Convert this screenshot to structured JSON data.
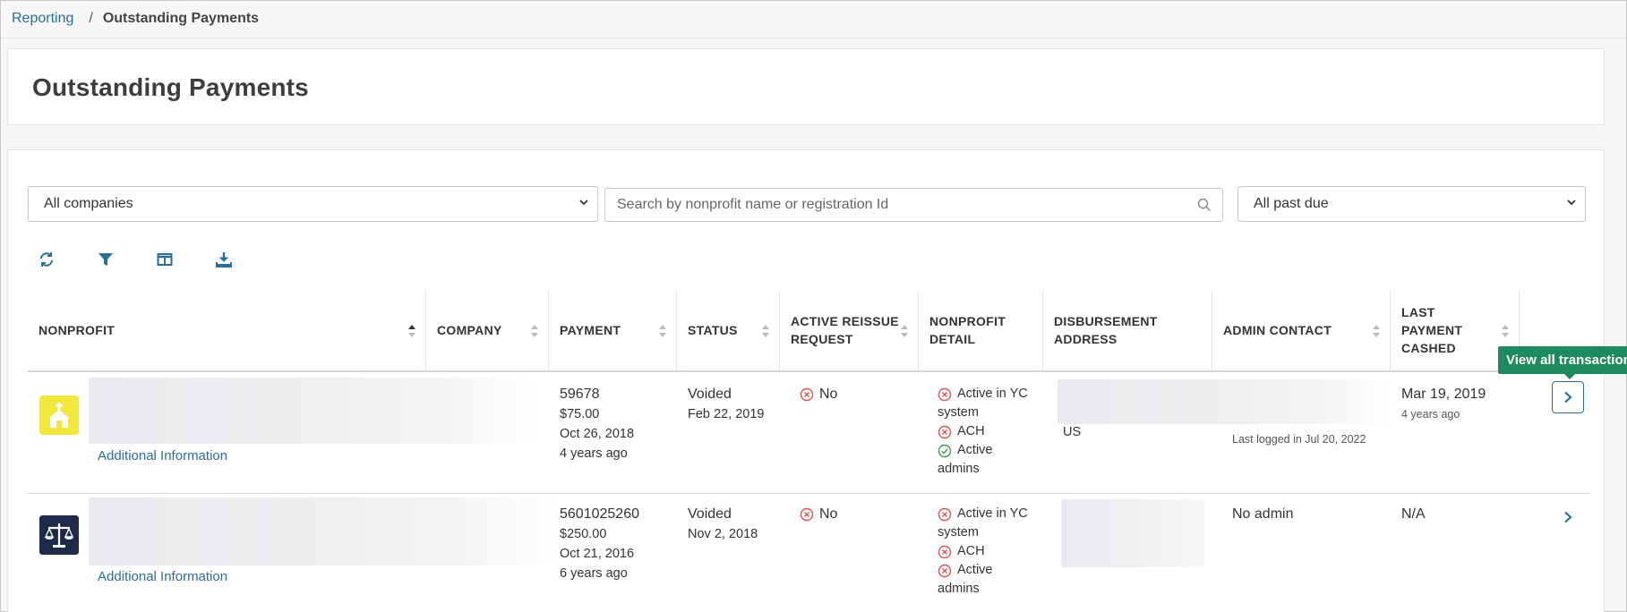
{
  "breadcrumb": {
    "parent": "Reporting",
    "separator": "/",
    "current": "Outstanding Payments"
  },
  "page_title": "Outstanding Payments",
  "filters": {
    "company_select": "All companies",
    "search_placeholder": "Search by nonprofit name or registration Id",
    "due_select": "All past due"
  },
  "toolbar": [
    "refresh-icon",
    "filter-icon",
    "columns-icon",
    "download-icon"
  ],
  "columns": {
    "nonprofit": "NONPROFIT",
    "company": "COMPANY",
    "payment": "PAYMENT",
    "status": "STATUS",
    "reissue": [
      "ACTIVE REISSUE",
      "REQUEST"
    ],
    "detail": [
      "NONPROFIT",
      "DETAIL"
    ],
    "address": [
      "DISBURSEMENT",
      "ADDRESS"
    ],
    "admin": "ADMIN CONTACT",
    "cashed": [
      "LAST",
      "PAYMENT",
      "CASHED"
    ]
  },
  "rows": [
    {
      "additional_info": "Additional Information",
      "payment_id": "59678",
      "amount": "$75.00",
      "date": "Oct 26, 2018",
      "relative": "4 years ago",
      "status": "Voided",
      "status_date": "Feb 22, 2019",
      "reissue": "No",
      "detail": {
        "yc_line1": "Active in YC",
        "yc_line2": "system",
        "ach": "ACH",
        "admins_line1": "Active",
        "admins_line2": "admins"
      },
      "address_country": "US",
      "admin_last_login": "Last logged in Jul 20, 2022",
      "last_cashed": "Mar 19, 2019",
      "last_cashed_relative": "4 years ago"
    },
    {
      "additional_info": "Additional Information",
      "payment_id": "5601025260",
      "amount": "$250.00",
      "date": "Oct 21, 2016",
      "relative": "6 years ago",
      "status": "Voided",
      "status_date": "Nov 2, 2018",
      "reissue": "No",
      "detail": {
        "yc_line1": "Active in YC",
        "yc_line2": "system",
        "ach": "ACH",
        "admins_line1": "Active",
        "admins_line2": "admins"
      },
      "admin": "No admin",
      "last_cashed": "N/A"
    }
  ],
  "tooltip": "View all transactions",
  "colors": {
    "link": "#2a6f97",
    "tooltip": "#1d8a60",
    "error": "#d9534f",
    "success": "#3c9d4a"
  }
}
